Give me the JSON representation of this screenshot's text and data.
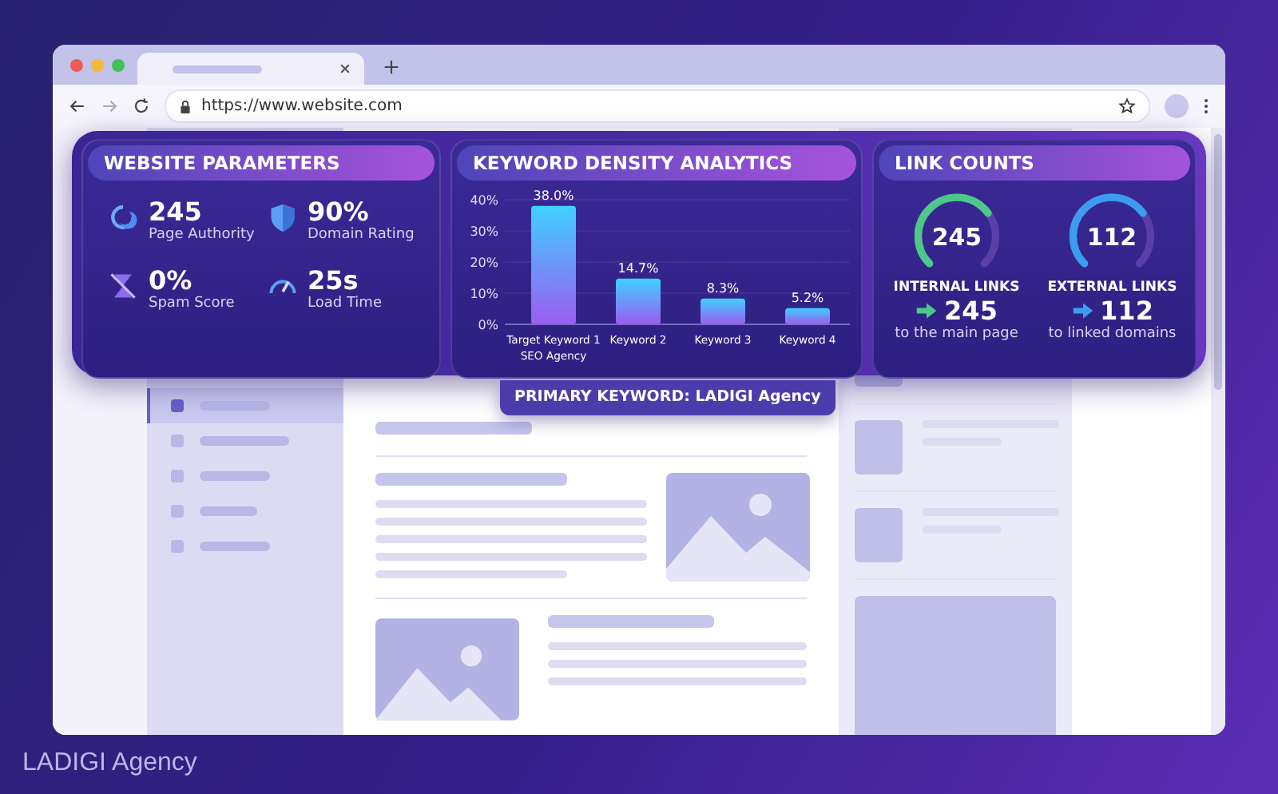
{
  "browser": {
    "url": "https://www.website.com",
    "tabs": [
      {
        "selected": true
      }
    ]
  },
  "sidebar": {
    "items": [
      {
        "selected": true
      },
      {
        "selected": false
      },
      {
        "selected": false
      },
      {
        "selected": false
      },
      {
        "selected": false
      }
    ]
  },
  "parameters": {
    "title": "WEBSITE PARAMETERS",
    "items": [
      {
        "kind": "authority",
        "value": "245",
        "label": "Page Authority"
      },
      {
        "kind": "rating",
        "value": "90%",
        "label": "Domain Rating"
      },
      {
        "kind": "spam",
        "value": "0%",
        "label": "Spam Score"
      },
      {
        "kind": "speed",
        "value": "25s",
        "label": "Load Time"
      }
    ]
  },
  "keyword_density": {
    "title": "KEYWORD DENSITY ANALYTICS",
    "chart_data": {
      "type": "bar",
      "grid": true,
      "categories": [
        "Target Keyword 1\nSEO Agency",
        "Keyword 2",
        "Keyword 3",
        "Keyword 4"
      ],
      "values": [
        38.0,
        14.7,
        8.3,
        5.2
      ],
      "ylim": [
        0,
        40
      ],
      "yticks": [
        {
          "value": 0,
          "label": "0%"
        },
        {
          "value": 10,
          "label": "10%"
        },
        {
          "value": 20,
          "label": "20%"
        },
        {
          "value": 30,
          "label": "30%"
        },
        {
          "value": 40,
          "label": "40%"
        }
      ],
      "data_labels": true,
      "value_labels": [
        "38.0%",
        "14.7%",
        "8.3%",
        "5.2%"
      ]
    },
    "primary_keyword": "PRIMARY KEYWORD: LADIGI Agency"
  },
  "link_counts": {
    "title": "LINK COUNTS",
    "items": [
      {
        "gauge": "245",
        "color": "#4cc98a",
        "label": "INTERNAL LINKS",
        "count": "245",
        "note": "to the main page"
      },
      {
        "gauge": "112",
        "color": "#3b9cf0",
        "label": "EXTERNAL LINKS",
        "count": "112",
        "note": "to linked domains"
      }
    ]
  },
  "footer": "LADIGI Agency"
}
